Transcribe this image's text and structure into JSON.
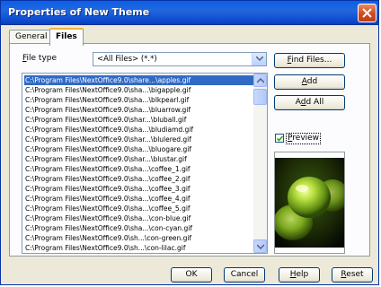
{
  "window": {
    "title": "Properties of New Theme"
  },
  "tabs": [
    {
      "label": "General",
      "active": false
    },
    {
      "label": "Files",
      "active": true
    }
  ],
  "file_type": {
    "label_prefix": "F",
    "label_rest": "ile type",
    "selected": "<All Files> (*.*)"
  },
  "file_list": {
    "items": [
      "C:\\Program Files\\NextOffice9.0\\share...\\apples.gif",
      "C:\\Program Files\\NextOffice9.0\\sha...\\bigapple.gif",
      "C:\\Program Files\\NextOffice9.0\\sha...\\blkpearl.gif",
      "C:\\Program Files\\NextOffice9.0\\sha...\\bluarrow.gif",
      "C:\\Program Files\\NextOffice9.0\\shar...\\bluball.gif",
      "C:\\Program Files\\NextOffice9.0\\sha...\\bludiamd.gif",
      "C:\\Program Files\\NextOffice9.0\\shar...\\blulered.gif",
      "C:\\Program Files\\NextOffice9.0\\sha...\\bluogare.gif",
      "C:\\Program Files\\NextOffice9.0\\shar...\\blustar.gif",
      "C:\\Program Files\\NextOffice9.0\\sha...\\coffee_1.gif",
      "C:\\Program Files\\NextOffice9.0\\sha...\\coffee_2.gif",
      "C:\\Program Files\\NextOffice9.0\\sha...\\coffee_3.gif",
      "C:\\Program Files\\NextOffice9.0\\sha...\\coffee_4.gif",
      "C:\\Program Files\\NextOffice9.0\\sha...\\coffee_5.gif",
      "C:\\Program Files\\NextOffice9.0\\sha...\\con-blue.gif",
      "C:\\Program Files\\NextOffice9.0\\sha...\\con-cyan.gif",
      "C:\\Program Files\\NextOffice9.0\\sh...\\con-green.gif",
      "C:\\Program Files\\NextOffice9.0\\sh...\\con-lilac.gif"
    ],
    "selected_index": 0
  },
  "buttons": {
    "find_files_prefix": "F",
    "find_files_rest": "ind Files...",
    "add_prefix": "A",
    "add_rest": "dd",
    "add_all_prefix": "Ad",
    "add_all_u": "d",
    "add_all_rest": " All",
    "ok": "OK",
    "cancel": "Cancel",
    "help_prefix": "H",
    "help_rest": "elp",
    "reset_prefix": "R",
    "reset_rest": "eset"
  },
  "preview": {
    "label_prefix": "P",
    "label_rest": "review",
    "checked": true
  },
  "colors": {
    "titlebar": "#0a5fe6",
    "selection": "#316ac5",
    "dialog_face": "#ece9d8"
  }
}
